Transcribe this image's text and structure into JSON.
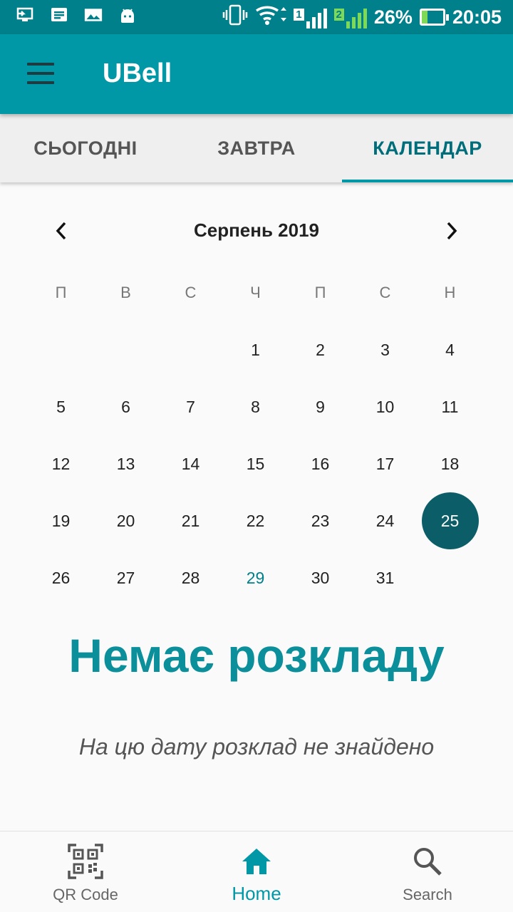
{
  "status_bar": {
    "sim1_label": "1",
    "sim2_label": "2",
    "battery": "26%",
    "battery_level": 0.26,
    "time": "20:05",
    "icons": [
      "usb-debug-icon",
      "notification-icon",
      "image-icon",
      "android-icon",
      "vibrate-icon",
      "wifi-icon",
      "signal-icon",
      "battery-charging-icon"
    ]
  },
  "app_bar": {
    "title": "UBell",
    "menu_icon": "hamburger-menu-icon"
  },
  "tabs": [
    {
      "label": "СЬОГОДНІ",
      "active": false
    },
    {
      "label": "ЗАВТРА",
      "active": false
    },
    {
      "label": "КАЛЕНДАР",
      "active": true
    }
  ],
  "calendar": {
    "month_label": "Серпень 2019",
    "prev_icon": "chevron-left-icon",
    "next_icon": "chevron-right-icon",
    "weekdays": [
      "П",
      "В",
      "С",
      "Ч",
      "П",
      "С",
      "Н"
    ],
    "weeks": [
      [
        "",
        "",
        "",
        "1",
        "2",
        "3",
        "4"
      ],
      [
        "5",
        "6",
        "7",
        "8",
        "9",
        "10",
        "11"
      ],
      [
        "12",
        "13",
        "14",
        "15",
        "16",
        "17",
        "18"
      ],
      [
        "19",
        "20",
        "21",
        "22",
        "23",
        "24",
        "25"
      ],
      [
        "26",
        "27",
        "28",
        "29",
        "30",
        "31",
        ""
      ]
    ],
    "selected_day": "25",
    "today": "29",
    "selected_color": "#0b5e68",
    "today_color": "#00808a"
  },
  "empty_state": {
    "title": "Немає розкладу",
    "subtitle": "На цю дату розклад не знайдено"
  },
  "bottom_nav": [
    {
      "label": "QR Code",
      "icon": "qr-code-icon",
      "active": false
    },
    {
      "label": "Home",
      "icon": "home-icon",
      "active": true
    },
    {
      "label": "Search",
      "icon": "search-icon",
      "active": false
    }
  ],
  "colors": {
    "status_bar": "#00808a",
    "app_bar": "#0097a7",
    "accent": "#0097a7",
    "title_teal": "#0a8f9b"
  }
}
